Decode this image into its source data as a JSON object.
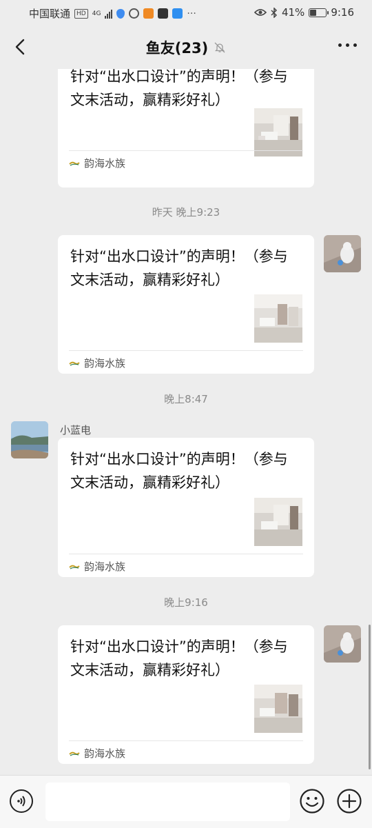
{
  "status_bar": {
    "carrier": "中国联通",
    "hd_badge": "HD",
    "network_type": "4G",
    "battery_percent": "41%",
    "battery_level": 0.41,
    "time": "9:16"
  },
  "header": {
    "title": "鱼友(23)"
  },
  "messages": [
    {
      "text": "针对“出水口设计”的声明！（参与文末活动，赢精彩好礼）",
      "source": "韵海水族"
    },
    {
      "time": "昨天 晚上9:23",
      "text": "针对“出水口设计”的声明！（参与文末活动，赢精彩好礼）",
      "source": "韵海水族"
    },
    {
      "time": "晚上8:47",
      "sender": "小蓝电",
      "text": "针对“出水口设计”的声明！（参与文末活动，赢精彩好礼）",
      "source": "韵海水族"
    },
    {
      "time": "晚上9:16",
      "text": "针对“出水口设计”的声明！（参与文末活动，赢精彩好礼）",
      "source": "韵海水族"
    }
  ],
  "input": {
    "placeholder": ""
  },
  "icons": [
    "back-arrow-icon",
    "mute-bell-icon",
    "more-icon",
    "voice-icon",
    "emoji-icon",
    "plus-icon"
  ],
  "colors": {
    "background": "#ededed",
    "card": "#ffffff",
    "timestamp": "#8a8a8a"
  }
}
